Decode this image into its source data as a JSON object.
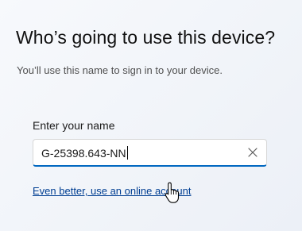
{
  "page": {
    "title": "Who’s going to use this device?",
    "subtitle": "You’ll use this name to sign in to your device."
  },
  "name_field": {
    "label": "Enter your name",
    "value": "G-25398.643-NN",
    "clear_icon": "close-icon"
  },
  "link": {
    "text": "Even better, use an online account"
  },
  "pointer": {
    "icon": "hand-pointer-icon"
  },
  "colors": {
    "accent": "#0067c0",
    "link": "#003e92"
  }
}
